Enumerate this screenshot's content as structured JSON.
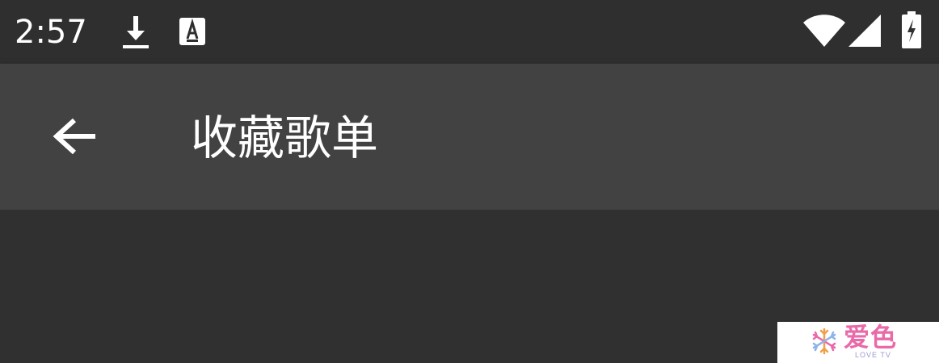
{
  "status_bar": {
    "time": "2:57",
    "left_icons": [
      "download-icon",
      "keyboard-a-icon"
    ],
    "right_icons": [
      "wifi-icon",
      "cell-signal-icon",
      "battery-charging-icon"
    ]
  },
  "app_bar": {
    "back_icon": "arrow-back-icon",
    "title": "收藏歌单"
  },
  "watermark": {
    "brand": "爱色",
    "sub": "LOVE TV"
  },
  "colors": {
    "status_bar_bg": "#2f2f2f",
    "app_bar_bg": "#424242",
    "content_bg": "#303030",
    "text": "#ffffff",
    "watermark_pink": "#e86aa8"
  }
}
